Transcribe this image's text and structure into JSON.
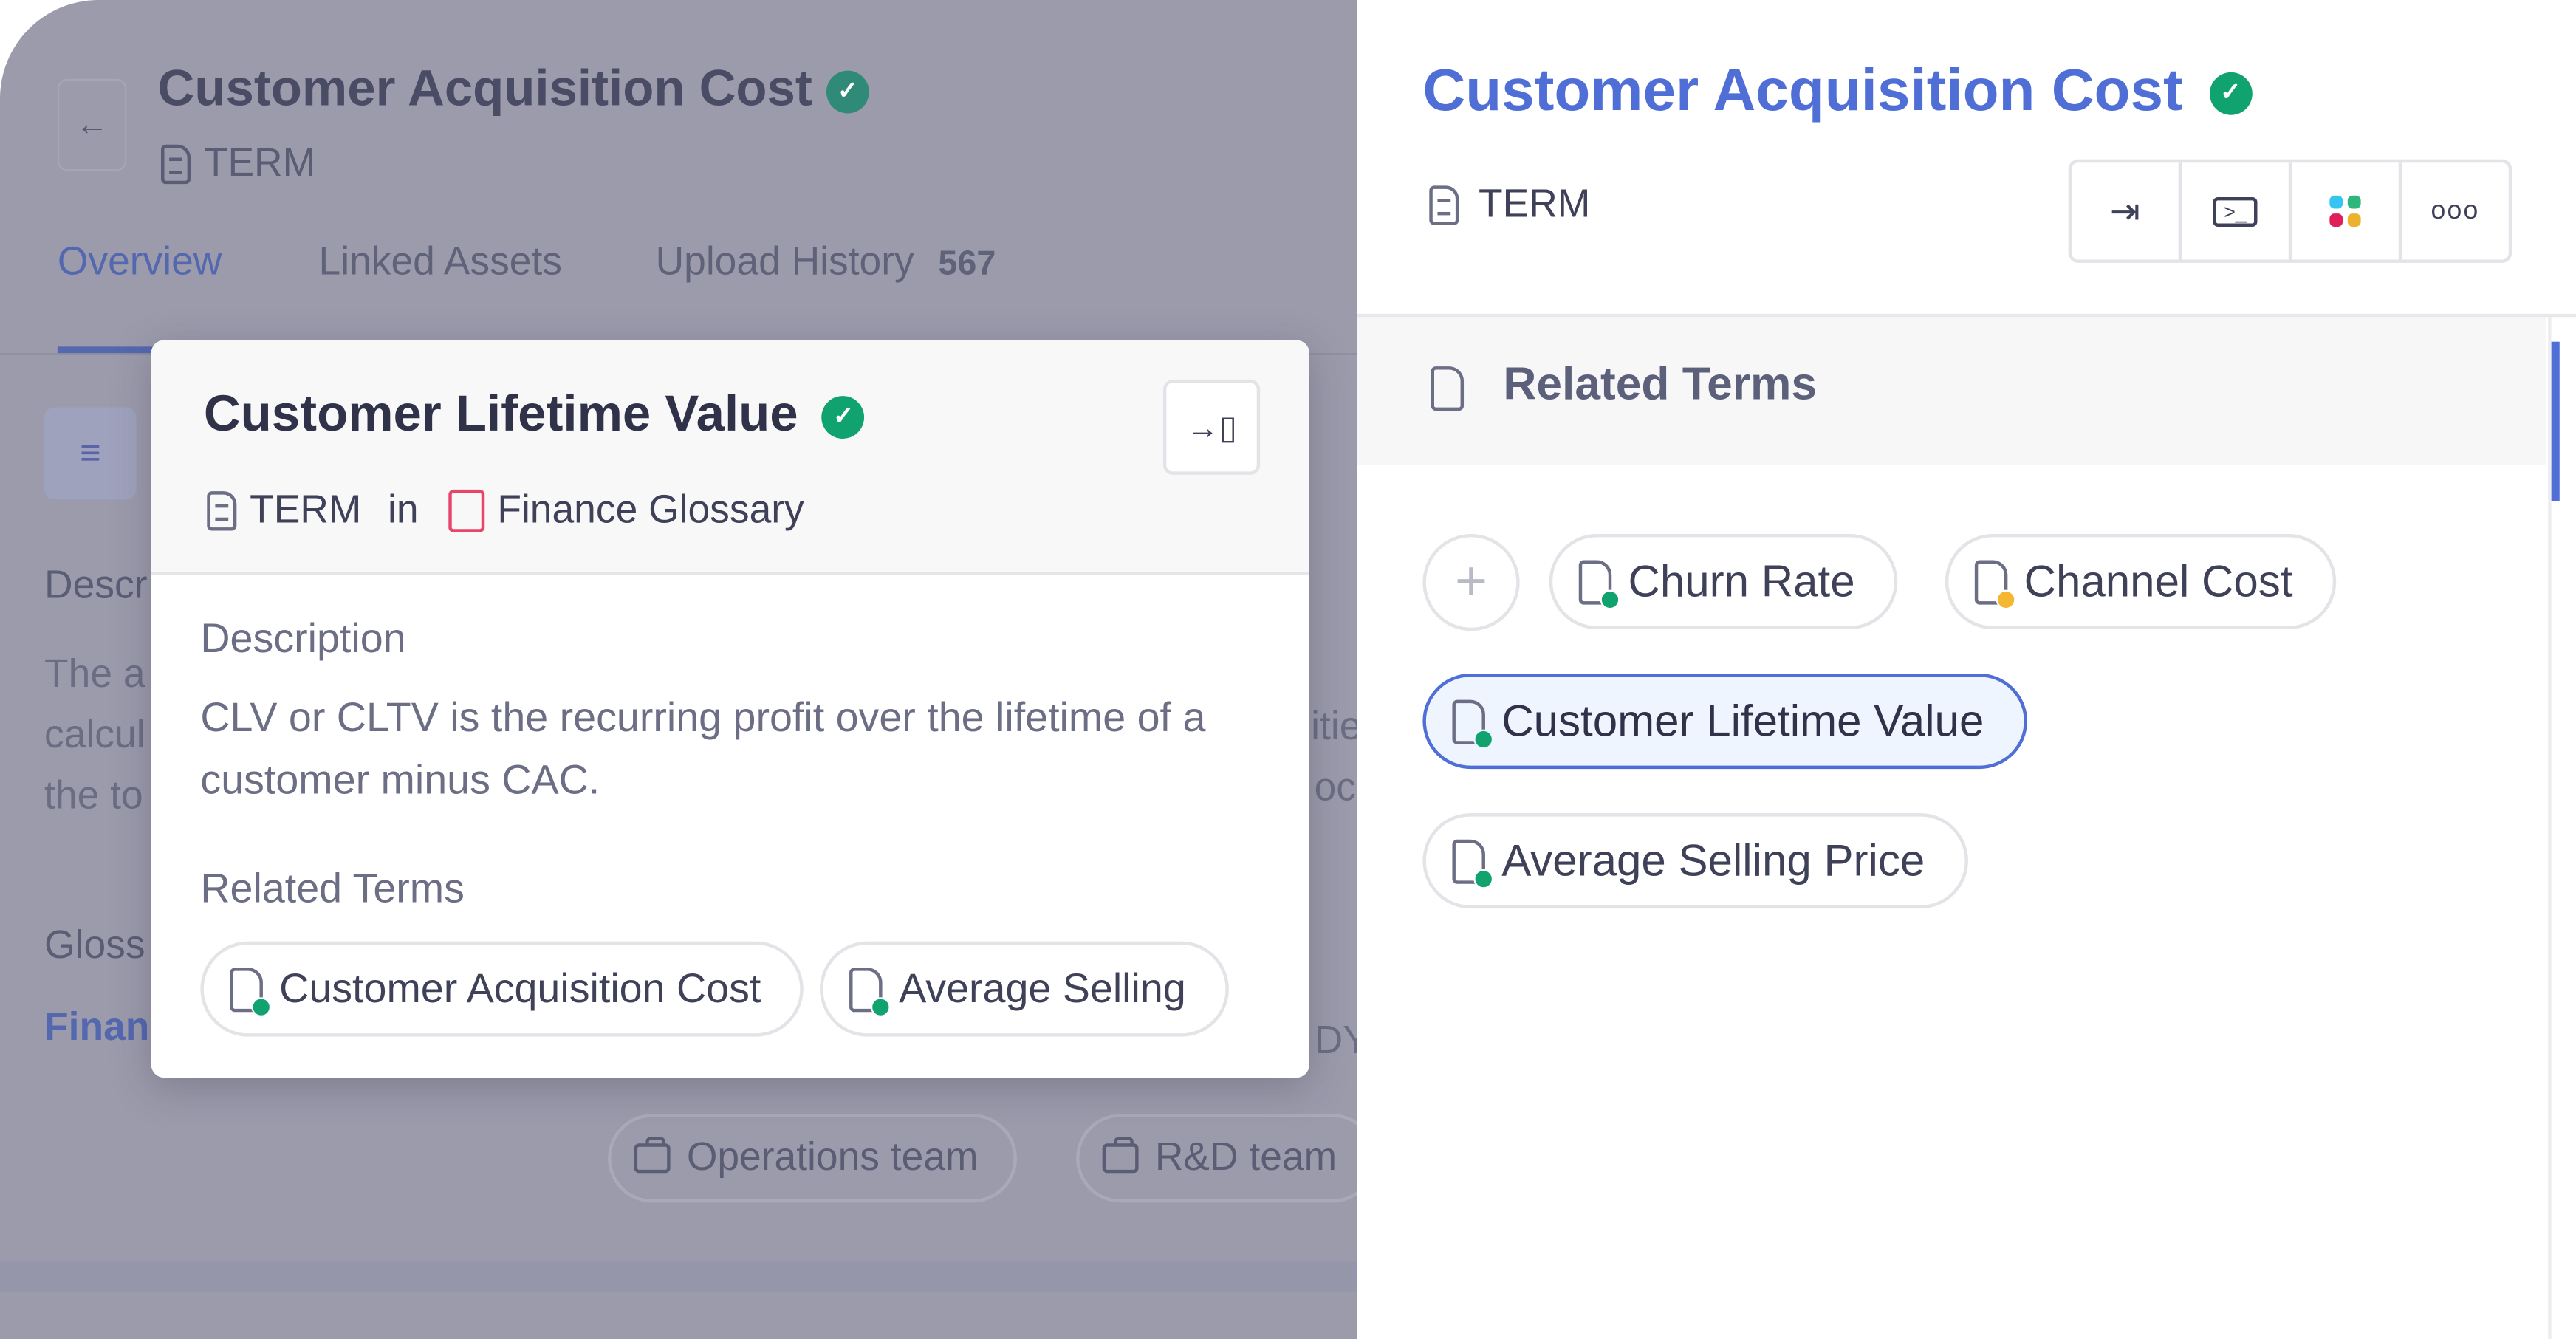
{
  "background_page": {
    "title": "Customer Acquisition Cost",
    "type_label": "TERM",
    "tabs": [
      {
        "label": "Overview",
        "active": true
      },
      {
        "label": "Linked Assets"
      },
      {
        "label": "Upload History",
        "count": "567"
      }
    ],
    "description_label_partial": "Descr",
    "description_partial_lines": [
      "The a",
      "calcul",
      "the to"
    ],
    "description_right_fragments": [
      "itie",
      "oc",
      "DY"
    ],
    "glossary_label_partial": "Gloss",
    "glossary_value_partial": "Finan",
    "owner_chips": [
      "Operations team",
      "R&D team"
    ]
  },
  "popup": {
    "title": "Customer Lifetime Value",
    "type_label": "TERM",
    "in_label": "in",
    "glossary": "Finance Glossary",
    "description_label": "Description",
    "description": "CLV or CLTV is the recurring profit over the lifetime of a customer minus CAC.",
    "related_label": "Related Terms",
    "related_terms": [
      {
        "label": "Customer Acquisition Cost",
        "status_color": "#10a36f"
      },
      {
        "label": "Average Selling",
        "status_color": "#10a36f"
      }
    ]
  },
  "sidebar": {
    "title": "Customer Acquisition Cost",
    "type_label": "TERM",
    "actions": [
      "open-icon",
      "terminal-icon",
      "slack-icon",
      "more-icon"
    ],
    "section_label": "Related Terms",
    "related_terms": [
      {
        "label": "Churn Rate",
        "status_color": "#10a36f"
      },
      {
        "label": "Channel Cost",
        "status_color": "#f5b731"
      },
      {
        "label": "Customer Lifetime Value",
        "status_color": "#10a36f",
        "selected": true
      },
      {
        "label": "Average Selling Price",
        "status_color": "#10a36f"
      }
    ]
  },
  "colors": {
    "accent": "#4f6fd6",
    "verified": "#10a36f",
    "glossary_icon": "#e8456b"
  }
}
